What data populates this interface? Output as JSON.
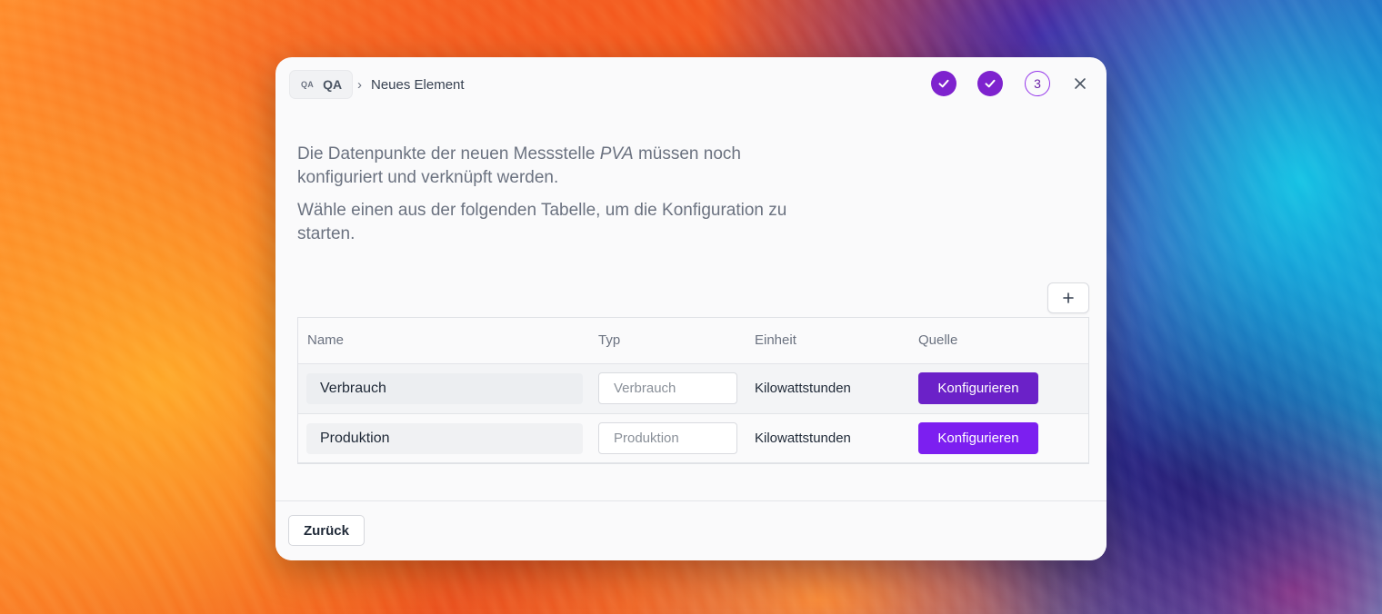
{
  "colors": {
    "accent": "#7e22ce",
    "button_primary": "#7c1ff0",
    "button_primary_hover": "#6b21c8",
    "dialog_bg": "#fafafb"
  },
  "header": {
    "workspace_abbr": "QA",
    "workspace_name": "QA",
    "breadcrumb_separator": "›",
    "breadcrumb_current": "Neues Element",
    "steps": [
      {
        "state": "done",
        "icon": "check-icon"
      },
      {
        "state": "done",
        "icon": "check-icon"
      },
      {
        "state": "current",
        "label": "3"
      }
    ],
    "close_icon": "close-icon"
  },
  "intro": {
    "p1_before": "Die Datenpunkte der neuen Messstelle ",
    "p1_em": "PVA",
    "p1_after": " müssen noch konfiguriert und verknüpft werden.",
    "p2": "Wähle einen aus der folgenden Tabelle, um die Konfiguration zu starten."
  },
  "toolbar": {
    "add_icon": "plus-icon"
  },
  "table": {
    "columns": [
      "Name",
      "Typ",
      "Einheit",
      "Quelle"
    ],
    "rows": [
      {
        "name": "Verbrauch",
        "typ_placeholder": "Verbrauch",
        "einheit": "Kilowattstunden",
        "action": "Konfigurieren"
      },
      {
        "name": "Produktion",
        "typ_placeholder": "Produktion",
        "einheit": "Kilowattstunden",
        "action": "Konfigurieren"
      }
    ]
  },
  "footer": {
    "back_label": "Zurück"
  }
}
